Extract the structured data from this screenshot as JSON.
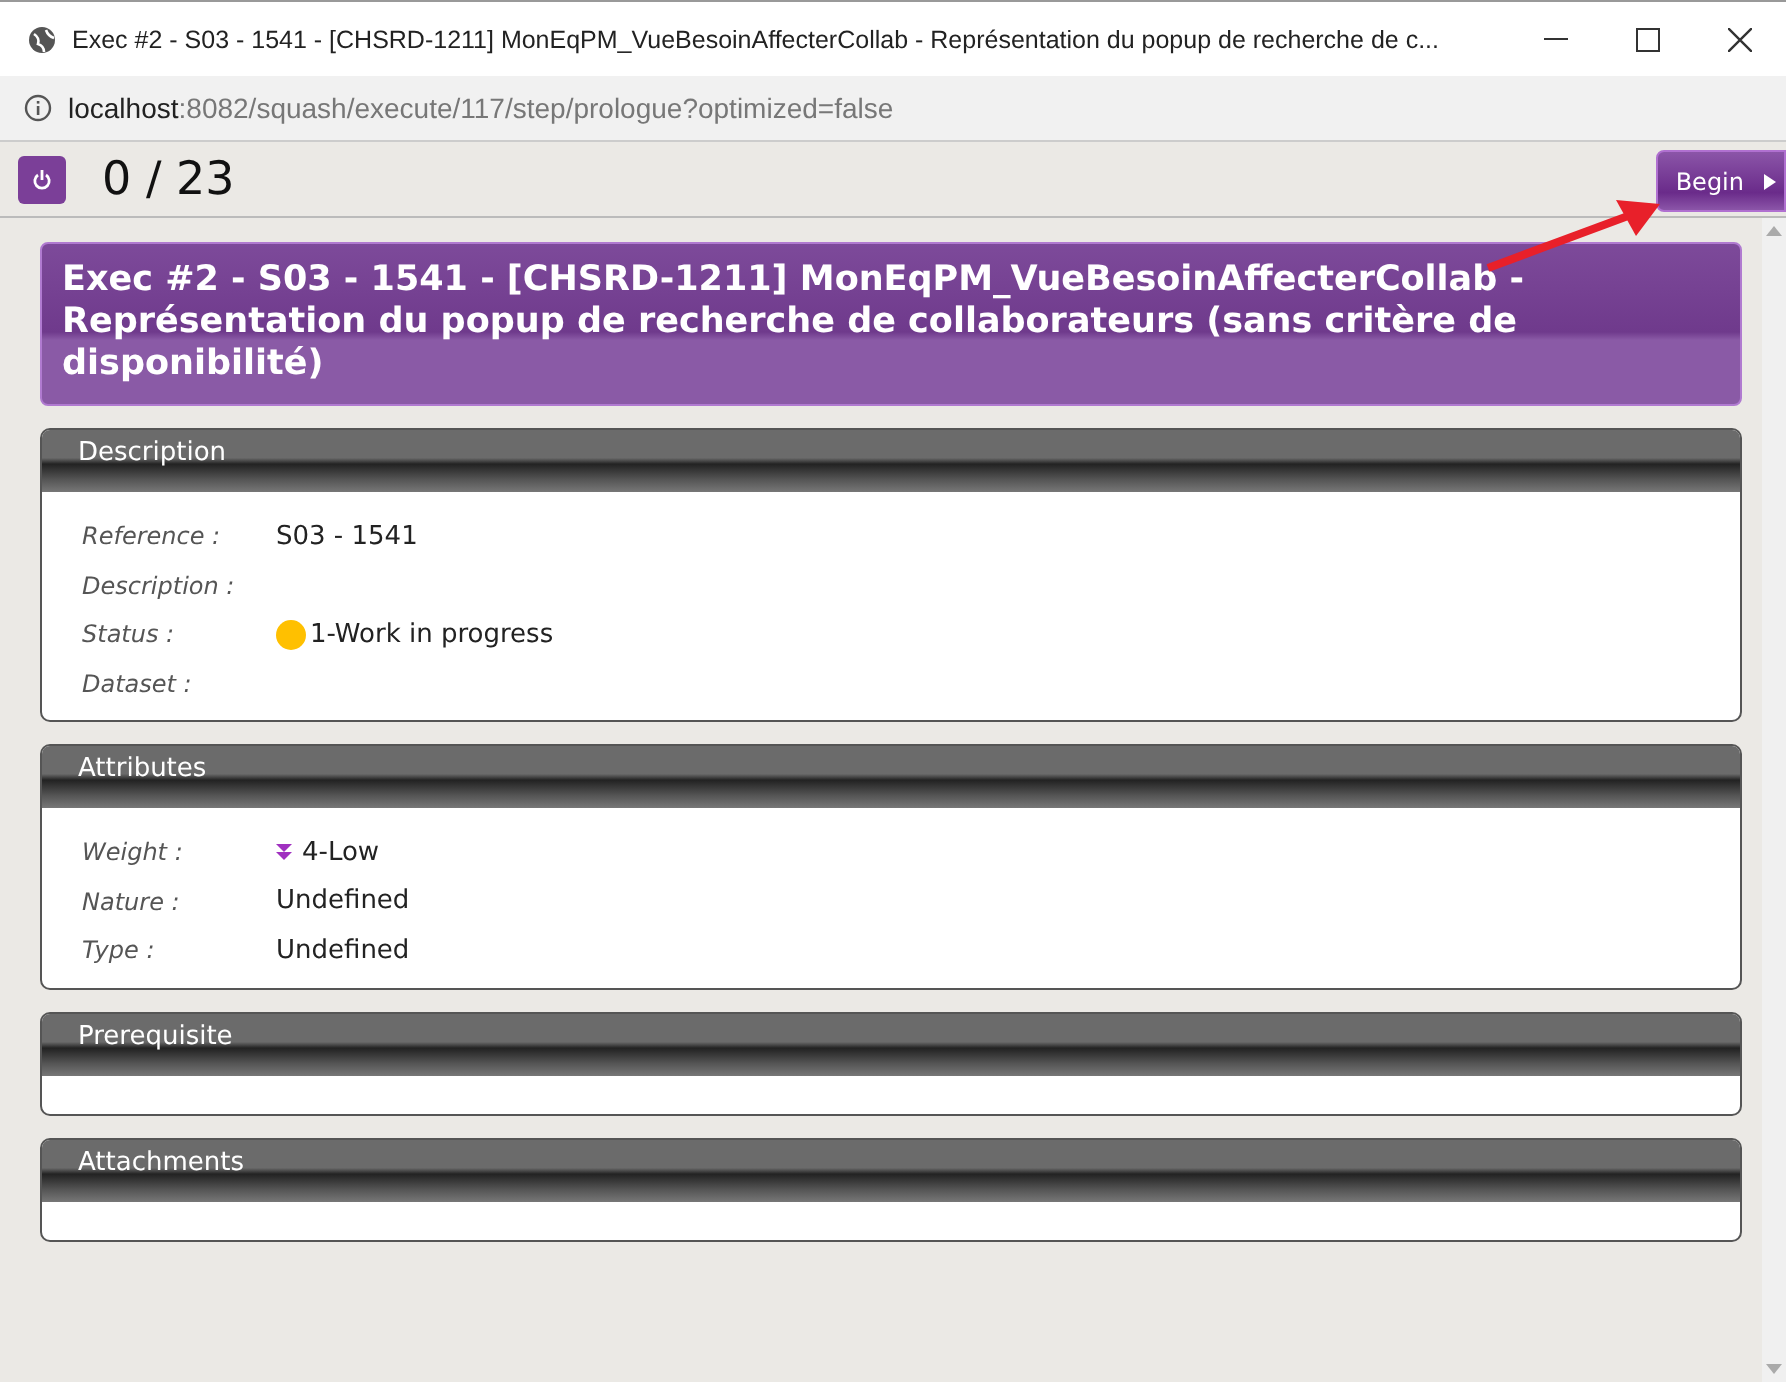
{
  "window": {
    "title": "Exec #2 - S03 - 1541 - [CHSRD-1211] MonEqPM_VueBesoinAffecterCollab - Représentation du popup de recherche de c..."
  },
  "address_bar": {
    "host": "localhost",
    "path": ":8082/squash/execute/117/step/prologue?optimized=false"
  },
  "toolbar": {
    "counter": "0 / 23",
    "begin_button": "Begin"
  },
  "heading": "Exec #2 - S03 - 1541 - [CHSRD-1211] MonEqPM_VueBesoinAffecterCollab - Représentation du popup de recherche de collaborateurs (sans critère de disponibilité)",
  "sections": [
    {
      "title": "Description",
      "rows": [
        {
          "kind": "text",
          "label": "Reference :",
          "value": "S03 - 1541"
        },
        {
          "kind": "text",
          "label": "Description :"
        },
        {
          "kind": "status",
          "label": "Status :",
          "value": "1-Work in progress",
          "color": "#ffc000"
        },
        {
          "kind": "text",
          "label": "Dataset :"
        }
      ]
    },
    {
      "title": "Attributes",
      "rows": [
        {
          "kind": "weight",
          "label": "Weight :",
          "value": "4-Low"
        },
        {
          "kind": "text",
          "label": "Nature :",
          "value": "Undefined"
        },
        {
          "kind": "text",
          "label": "Type :",
          "value": "Undefined"
        }
      ]
    },
    {
      "title": "Prerequisite"
    },
    {
      "title": "Attachments"
    }
  ]
}
